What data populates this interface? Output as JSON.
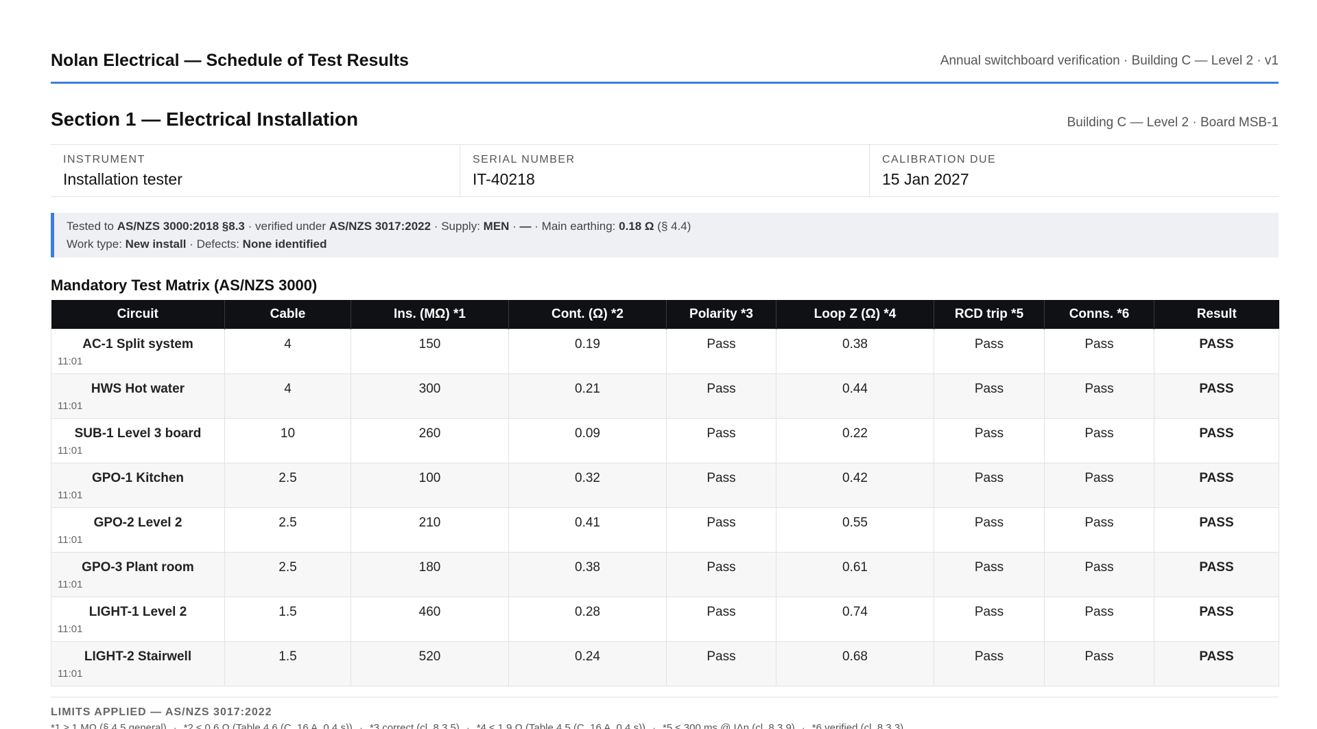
{
  "header": {
    "title": "Nolan Electrical — Schedule of Test Results",
    "meta": "Annual switchboard verification · Building C — Level 2 · v1"
  },
  "section": {
    "title": "Section 1 — Electrical Installation",
    "location": "Building C — Level 2 · Board MSB-1"
  },
  "instrument": [
    {
      "label": "Instrument",
      "value": "Installation tester"
    },
    {
      "label": "Serial Number",
      "value": "IT-40218"
    },
    {
      "label": "Calibration Due",
      "value": "15 Jan 2027"
    }
  ],
  "info": {
    "tested_prefix": "Tested to ",
    "standard": "AS/NZS 3000:2018 §8.3",
    "verified_prefix": " · verified under ",
    "verified_standard": "AS/NZS 3017:2022",
    "supply_prefix": "Supply: ",
    "supply": "MEN",
    "dash": "—",
    "earthing_prefix": "Main earthing: ",
    "earthing_value": "0.18 Ω",
    "earthing_ref": " (§ 4.4)",
    "work_prefix": "Work type: ",
    "work_type": "New install",
    "defects_prefix": "Defects: ",
    "defects": "None identified"
  },
  "matrix": {
    "title": "Mandatory Test Matrix (AS/NZS 3000)",
    "headers": [
      "Circuit",
      "Cable",
      "Ins. (MΩ) *1",
      "Cont. (Ω) *2",
      "Polarity *3",
      "Loop Z (Ω) *4",
      "RCD trip *5",
      "Conns. *6",
      "Result"
    ],
    "rows": [
      {
        "circuit": "AC-1 Split system",
        "time": "11:01",
        "cable": "4",
        "ins": "150",
        "cont": "0.19",
        "polarity": "Pass",
        "loop": "0.38",
        "rcd": "Pass",
        "conns": "Pass",
        "result": "PASS"
      },
      {
        "circuit": "HWS Hot water",
        "time": "11:01",
        "cable": "4",
        "ins": "300",
        "cont": "0.21",
        "polarity": "Pass",
        "loop": "0.44",
        "rcd": "Pass",
        "conns": "Pass",
        "result": "PASS"
      },
      {
        "circuit": "SUB-1 Level 3 board",
        "time": "11:01",
        "cable": "10",
        "ins": "260",
        "cont": "0.09",
        "polarity": "Pass",
        "loop": "0.22",
        "rcd": "Pass",
        "conns": "Pass",
        "result": "PASS"
      },
      {
        "circuit": "GPO-1 Kitchen",
        "time": "11:01",
        "cable": "2.5",
        "ins": "100",
        "cont": "0.32",
        "polarity": "Pass",
        "loop": "0.42",
        "rcd": "Pass",
        "conns": "Pass",
        "result": "PASS"
      },
      {
        "circuit": "GPO-2 Level 2",
        "time": "11:01",
        "cable": "2.5",
        "ins": "210",
        "cont": "0.41",
        "polarity": "Pass",
        "loop": "0.55",
        "rcd": "Pass",
        "conns": "Pass",
        "result": "PASS"
      },
      {
        "circuit": "GPO-3 Plant room",
        "time": "11:01",
        "cable": "2.5",
        "ins": "180",
        "cont": "0.38",
        "polarity": "Pass",
        "loop": "0.61",
        "rcd": "Pass",
        "conns": "Pass",
        "result": "PASS"
      },
      {
        "circuit": "LIGHT-1 Level 2",
        "time": "11:01",
        "cable": "1.5",
        "ins": "460",
        "cont": "0.28",
        "polarity": "Pass",
        "loop": "0.74",
        "rcd": "Pass",
        "conns": "Pass",
        "result": "PASS"
      },
      {
        "circuit": "LIGHT-2 Stairwell",
        "time": "11:01",
        "cable": "1.5",
        "ins": "520",
        "cont": "0.24",
        "polarity": "Pass",
        "loop": "0.68",
        "rcd": "Pass",
        "conns": "Pass",
        "result": "PASS"
      }
    ]
  },
  "limits": {
    "title": "Limits Applied — AS/NZS 3017:2022",
    "items": [
      "*1 ≥ 1 MΩ (§ 4.5 general)",
      "*2 ≤ 0.6 Ω (Table 4.6 (C, 16 A, 0.4 s))",
      "*3 correct (cl. 8.3.5)",
      "*4 ≤ 1.9 Ω (Table 4.5 (C, 16 A, 0.4 s))",
      "*5 ≤ 300 ms @ IΔn (cl. 8.3.9)",
      "*6 verified (cl. 8.3.3)"
    ]
  },
  "colors": {
    "accent": "#3d7ee3",
    "header_bg": "#0f1114",
    "info_bg": "#eef0f4"
  }
}
